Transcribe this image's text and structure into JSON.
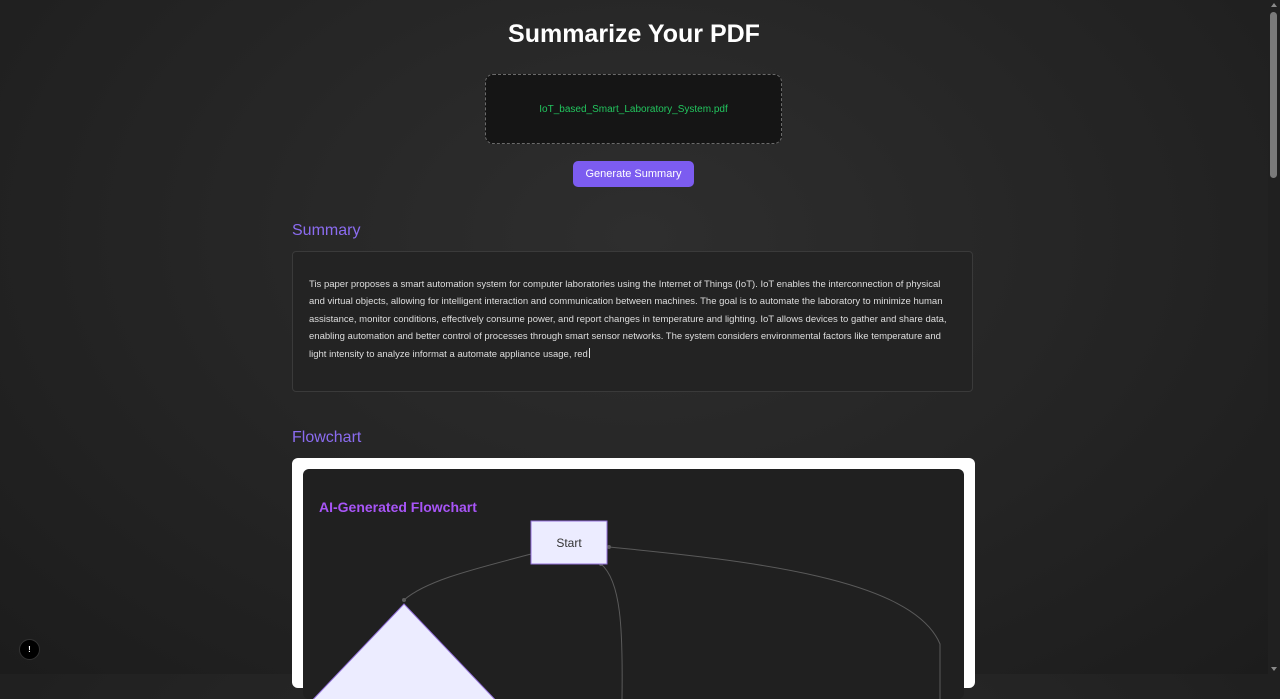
{
  "header": {
    "title": "Summarize Your PDF"
  },
  "upload": {
    "file_name": "IoT_based_Smart_Laboratory_System.pdf"
  },
  "actions": {
    "generate_label": "Generate Summary"
  },
  "summary": {
    "heading": "Summary",
    "text": "Tis paper proposes a smart automation system for computer laboratories using the Internet of Things (IoT). IoT enables the interconnection of physical and virtual objects, allowing for intelligent interaction and communication between machines. The goal is to automate the laboratory to minimize human assistance, monitor conditions, effectively consume power, and report changes in temperature and lighting. IoT allows devices to gather and share data, enabling automation and better control of processes through smart sensor networks. The system considers environmental factors like temperature and light intensity to analyze informat a automate appliance usage, red"
  },
  "flowchart": {
    "heading": "Flowchart",
    "title": "AI-Generated Flowchart",
    "start_node": "Start"
  },
  "help": {
    "icon_glyph": "!"
  },
  "colors": {
    "accent": "#7c5cf0",
    "heading": "#8b6cf0",
    "file_name": "#22c55e",
    "flow_title": "#a855f7",
    "node_fill": "#ececff"
  },
  "icons": {
    "help": "help-icon"
  }
}
